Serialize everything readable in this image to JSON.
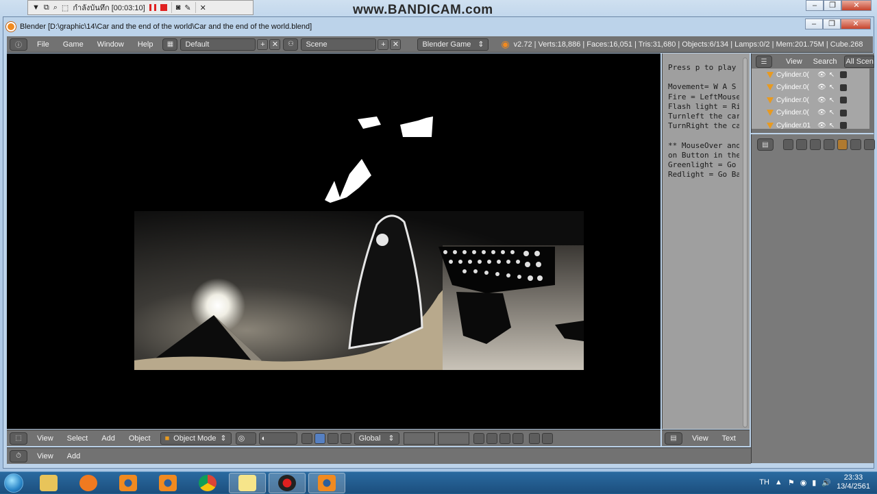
{
  "recorder": {
    "status_timer": "กำลังบันทึก [00:03:10]",
    "watermark": "www.BANDICAM.com"
  },
  "window": {
    "title": "Blender [D:\\graphic\\14\\Car and the end of the world\\Car and the end of the world.blend]"
  },
  "info_header": {
    "menus": [
      "File",
      "Game",
      "Window",
      "Help"
    ],
    "layout": "Default",
    "scene": "Scene",
    "engine": "Blender Game",
    "stats": "v2.72 | Verts:18,886 | Faces:16,051 | Tris:31,680 | Objects:6/134 | Lamps:0/2 | Mem:201.75M | Cube.268"
  },
  "text_editor": {
    "content": "Press p to play\n\nMovement= W A S\nFire = LeftMouse\nFlash light = Ri\nTurnleft the car\nTurnRight the ca\n\n** MouseOver and\non Button in the\nGreenlight = Go \nRedlight = Go Ba",
    "header_menus": [
      "View",
      "Text"
    ]
  },
  "outliner": {
    "header_menus": [
      "View",
      "Search"
    ],
    "filter": "All Scen",
    "items": [
      "Cylinder.0(",
      "Cylinder.0(",
      "Cylinder.0(",
      "Cylinder.0(",
      "Cylinder.01"
    ]
  },
  "viewport_header": {
    "menus": [
      "View",
      "Select",
      "Add",
      "Object"
    ],
    "mode": "Object Mode",
    "orientation": "Global"
  },
  "timeline_header": {
    "menus": [
      "View",
      "Add"
    ]
  },
  "taskbar": {
    "language": "TH",
    "time": "23:33",
    "date": "13/4/2561"
  },
  "colors": {
    "blender_header": "#727272",
    "text_editor_bg": "#9f9f9f",
    "taskbar": "#1c4f7e",
    "accent_orange": "#e89a20"
  }
}
